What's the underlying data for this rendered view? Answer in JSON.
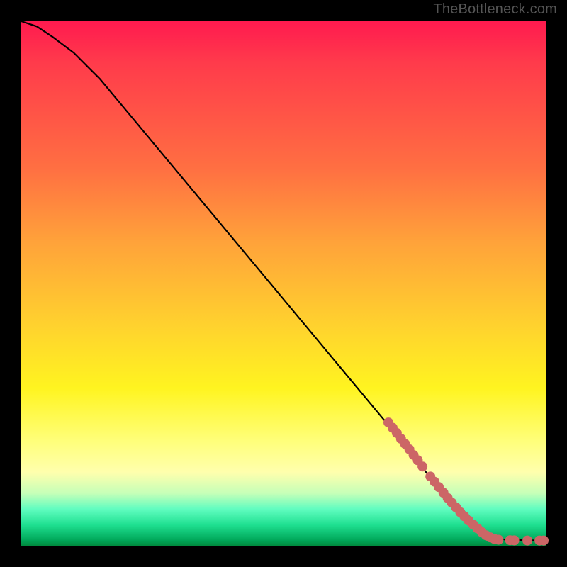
{
  "attribution": "TheBottleneck.com",
  "colors": {
    "frame": "#000000",
    "curve": "#000000",
    "marker_fill": "#cc6666",
    "marker_stroke": "#cc6666"
  },
  "chart_data": {
    "type": "line",
    "title": "",
    "xlabel": "",
    "ylabel": "",
    "xlim": [
      0,
      100
    ],
    "ylim": [
      0,
      100
    ],
    "grid": false,
    "legend": false,
    "series": [
      {
        "name": "curve",
        "kind": "line",
        "x": [
          0,
          3,
          6,
          10,
          15,
          20,
          25,
          30,
          35,
          40,
          45,
          50,
          55,
          60,
          65,
          70,
          74,
          78,
          82,
          85,
          87,
          89,
          90,
          92,
          94,
          96,
          98,
          100
        ],
        "y": [
          100,
          99,
          97,
          94,
          89,
          83,
          77,
          71,
          65,
          59,
          53,
          47,
          41,
          35,
          29,
          23,
          18,
          13,
          9,
          6,
          4,
          2,
          1.5,
          1.2,
          1.1,
          1.05,
          1.02,
          1.0
        ]
      },
      {
        "name": "markers",
        "kind": "scatter",
        "points": [
          {
            "x": 70.0,
            "y": 23.5
          },
          {
            "x": 70.8,
            "y": 22.5
          },
          {
            "x": 71.6,
            "y": 21.5
          },
          {
            "x": 72.4,
            "y": 20.4
          },
          {
            "x": 73.2,
            "y": 19.4
          },
          {
            "x": 74.0,
            "y": 18.4
          },
          {
            "x": 74.8,
            "y": 17.3
          },
          {
            "x": 75.6,
            "y": 16.3
          },
          {
            "x": 76.5,
            "y": 15.1
          },
          {
            "x": 78.0,
            "y": 13.2
          },
          {
            "x": 78.8,
            "y": 12.2
          },
          {
            "x": 79.6,
            "y": 11.2
          },
          {
            "x": 80.5,
            "y": 10.1
          },
          {
            "x": 81.3,
            "y": 9.1
          },
          {
            "x": 82.1,
            "y": 8.2
          },
          {
            "x": 82.9,
            "y": 7.3
          },
          {
            "x": 83.7,
            "y": 6.4
          },
          {
            "x": 84.5,
            "y": 5.6
          },
          {
            "x": 85.3,
            "y": 4.8
          },
          {
            "x": 86.2,
            "y": 4.0
          },
          {
            "x": 87.0,
            "y": 3.3
          },
          {
            "x": 87.8,
            "y": 2.6
          },
          {
            "x": 88.6,
            "y": 2.0
          },
          {
            "x": 89.4,
            "y": 1.6
          },
          {
            "x": 90.2,
            "y": 1.3
          },
          {
            "x": 91.0,
            "y": 1.15
          },
          {
            "x": 93.2,
            "y": 1.05
          },
          {
            "x": 94.0,
            "y": 1.03
          },
          {
            "x": 96.5,
            "y": 1.0
          },
          {
            "x": 98.8,
            "y": 1.0
          },
          {
            "x": 99.6,
            "y": 1.0
          }
        ]
      }
    ]
  }
}
